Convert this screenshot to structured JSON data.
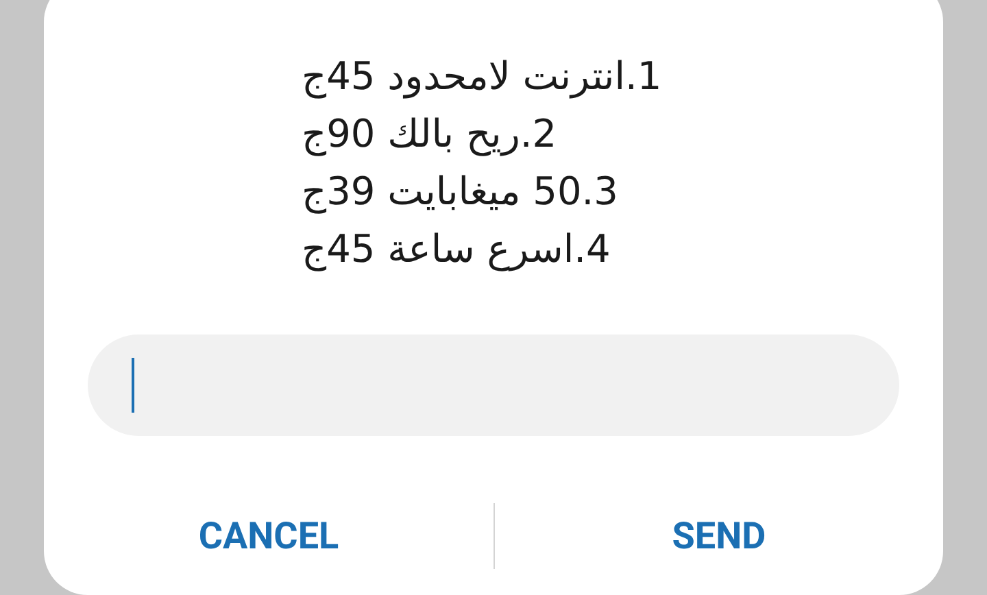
{
  "message": {
    "lines": [
      "1.انترنت لامحدود 45ج",
      "2.ريح بالك 90ج",
      "50.3 ميغابايت 39ج",
      "4.اسرع ساعة 45ج"
    ]
  },
  "reply_field": {
    "focused": true
  },
  "cancel_button": {
    "label": "CANCEL"
  },
  "send_button": {
    "label": "SEND"
  }
}
